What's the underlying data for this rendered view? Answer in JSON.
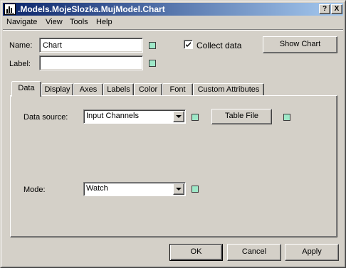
{
  "window": {
    "title": ".Models.MojeSlozka.MujModel.Chart",
    "help_glyph": "?",
    "close_glyph": "X"
  },
  "menu": {
    "items": [
      "Navigate",
      "View",
      "Tools",
      "Help"
    ]
  },
  "form": {
    "name_label": "Name:",
    "name_value": "Chart",
    "label_label": "Label:",
    "label_value": "",
    "collect_data_label": "Collect data",
    "collect_data_checked": true,
    "show_chart_label": "Show Chart"
  },
  "tabs": [
    {
      "label": "Data",
      "active": true
    },
    {
      "label": "Display",
      "active": false
    },
    {
      "label": "Axes",
      "active": false
    },
    {
      "label": "Labels",
      "active": false
    },
    {
      "label": "Color",
      "active": false
    },
    {
      "label": "Font",
      "active": false
    },
    {
      "label": "Custom Attributes",
      "active": false
    }
  ],
  "data_tab": {
    "data_source_label": "Data source:",
    "data_source_value": "Input Channels",
    "table_file_label": "Table File",
    "mode_label": "Mode:",
    "mode_value": "Watch"
  },
  "footer": {
    "ok_label": "OK",
    "cancel_label": "Cancel",
    "apply_label": "Apply"
  },
  "colors": {
    "marker": "#9ee8c8",
    "titlebar_start": "#0a246a",
    "titlebar_end": "#a6caf0",
    "face": "#d4d0c8"
  }
}
